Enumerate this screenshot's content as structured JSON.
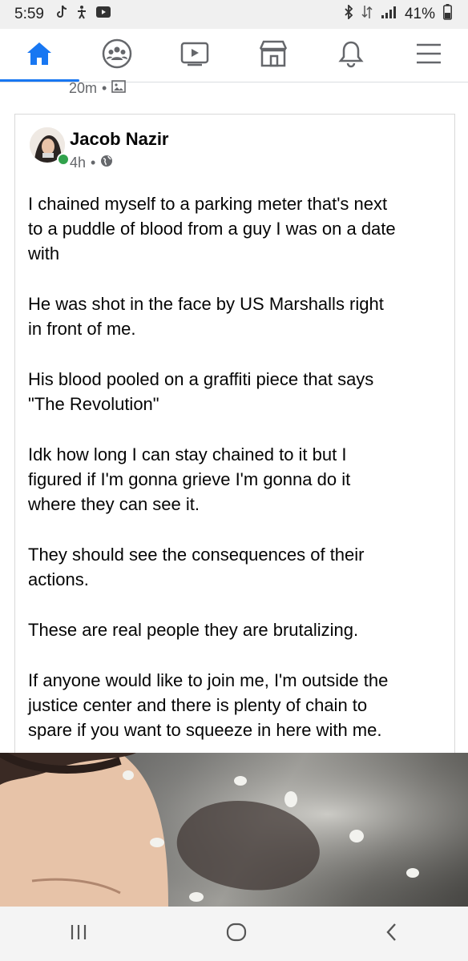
{
  "status_bar": {
    "time": "5:59",
    "battery": "41%",
    "icons": [
      "tiktok-icon",
      "accessibility-icon",
      "youtube-icon",
      "bluetooth-icon",
      "data-icon",
      "signal-icon",
      "battery-icon"
    ]
  },
  "nav": {
    "items": [
      {
        "icon": "home-icon",
        "active": true
      },
      {
        "icon": "groups-icon",
        "active": false
      },
      {
        "icon": "watch-icon",
        "active": false
      },
      {
        "icon": "marketplace-icon",
        "active": false
      },
      {
        "icon": "notifications-icon",
        "active": false
      },
      {
        "icon": "menu-icon",
        "active": false
      }
    ],
    "accent": "#1877f2"
  },
  "prev_post": {
    "time": "20m",
    "separator": "•"
  },
  "post": {
    "author": "Jacob Nazir",
    "time": "4h",
    "separator": "•",
    "paragraphs": [
      "I chained myself to a parking meter that's next\nto a puddle of blood from a guy I was on a date\nwith",
      "He was shot in the face by US Marshalls right\nin front of me.",
      "His blood pooled on a graffiti piece that says\n\"The Revolution\"",
      "Idk how long I can stay chained to it but I\nfigured if I'm gonna grieve I'm gonna do it\nwhere they can see it.",
      "They should see the consequences of their\nactions.",
      "These are real people they are brutalizing.",
      "If anyone would like to join me, I'm outside the\njustice center and there is plenty of chain to\nspare if you want to squeeze in here with me."
    ]
  },
  "bottom_nav": {
    "icons": [
      "recents-icon",
      "home-button-icon",
      "back-icon"
    ]
  }
}
